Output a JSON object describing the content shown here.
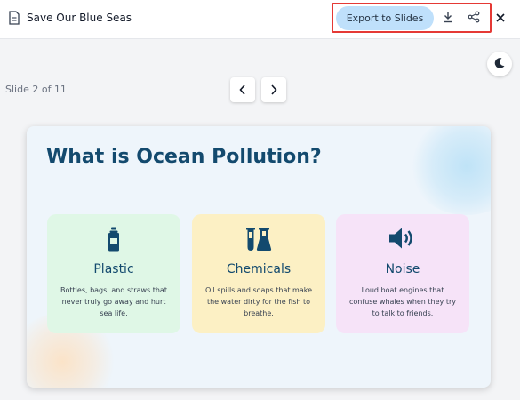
{
  "header": {
    "title": "Save Our Blue Seas",
    "export_label": "Export to Slides"
  },
  "navigation": {
    "slide_counter": "Slide 2 of 11"
  },
  "slide": {
    "title": "What is Ocean Pollution?",
    "cards": [
      {
        "icon": "bottle-icon",
        "title": "Plastic",
        "description": "Bottles, bags, and straws that never truly go away and hurt sea life.",
        "bg": "#dff7e6"
      },
      {
        "icon": "flask-icon",
        "title": "Chemicals",
        "description": "Oil spills and soaps that make the water dirty for the fish to breathe.",
        "bg": "#fcf0c4"
      },
      {
        "icon": "speaker-icon",
        "title": "Noise",
        "description": "Loud boat engines that confuse whales when they try to talk to friends.",
        "bg": "#f6e3f8"
      }
    ]
  },
  "colors": {
    "accent": "#134a6e",
    "export_bg": "#bfe0fb",
    "highlight": "#e53935"
  }
}
